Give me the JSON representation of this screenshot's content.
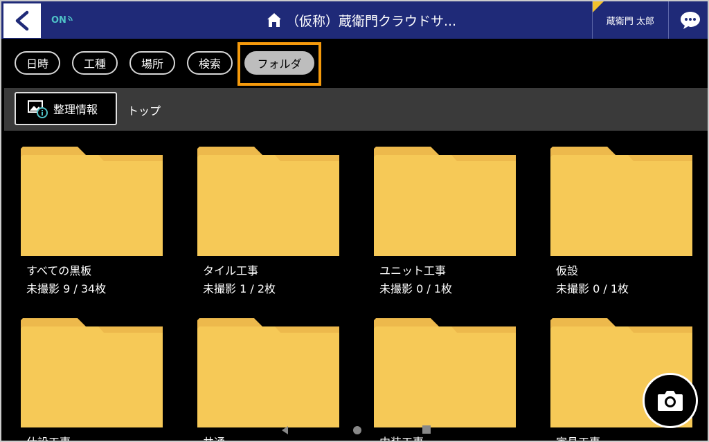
{
  "header": {
    "back_icon": "chevron-left-icon",
    "status": "ON",
    "status_icon": "wifi-signal-icon",
    "home_icon": "home-icon",
    "title": "（仮称）蔵衛門クラウドサ...",
    "user": "蔵衛門 太郎",
    "chat_icon": "chat-bubble-icon"
  },
  "tabs": [
    {
      "label": "日時",
      "active": false
    },
    {
      "label": "工種",
      "active": false
    },
    {
      "label": "場所",
      "active": false
    },
    {
      "label": "検索",
      "active": false
    },
    {
      "label": "フォルダ",
      "active": true
    }
  ],
  "pathbar": {
    "organize_label": "整理情報",
    "organize_icon": "photo-info-icon",
    "breadcrumb": "トップ"
  },
  "folders": [
    {
      "name": "すべての黒板",
      "count": "未撮影 9 / 34枚"
    },
    {
      "name": "タイル工事",
      "count": "未撮影 1 / 2枚"
    },
    {
      "name": "ユニット工事",
      "count": "未撮影 0 / 1枚"
    },
    {
      "name": "仮設",
      "count": "未撮影 0 / 1枚"
    },
    {
      "name": "仕設工事",
      "count": ""
    },
    {
      "name": "共通",
      "count": ""
    },
    {
      "name": "内装工事",
      "count": ""
    },
    {
      "name": "家具工事",
      "count": ""
    }
  ],
  "camera_icon": "camera-icon",
  "nav": {
    "back_icon": "nav-back-icon",
    "home_icon": "nav-home-icon",
    "recents_icon": "nav-recents-icon"
  },
  "colors": {
    "header": "#1f2a78",
    "accent": "#f59a0c",
    "folder": "#f6c957",
    "folder_tab": "#edb94c",
    "status": "#4fc3c8"
  }
}
